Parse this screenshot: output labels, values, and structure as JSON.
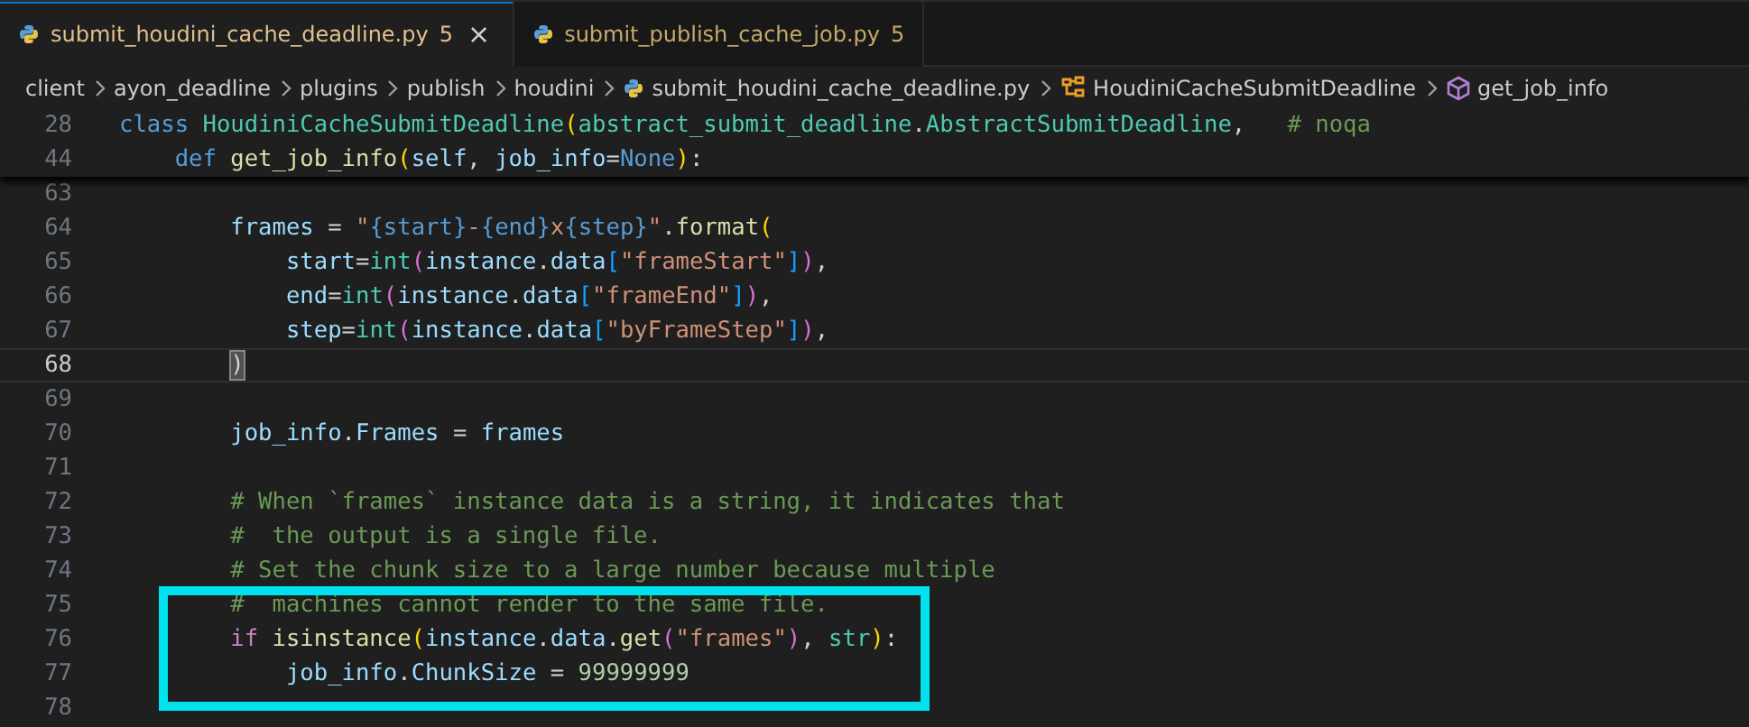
{
  "tabs": [
    {
      "label": "submit_houdini_cache_deadline.py",
      "problems": "5",
      "close": "×",
      "selected": true
    },
    {
      "label": "submit_publish_cache_job.py",
      "problems": "5",
      "selected": false
    }
  ],
  "breadcrumbs": [
    {
      "label": "client",
      "kind": "folder"
    },
    {
      "label": "ayon_deadline",
      "kind": "folder"
    },
    {
      "label": "plugins",
      "kind": "folder"
    },
    {
      "label": "publish",
      "kind": "folder"
    },
    {
      "label": "houdini",
      "kind": "folder"
    },
    {
      "label": "submit_houdini_cache_deadline.py",
      "kind": "file"
    },
    {
      "label": "HoudiniCacheSubmitDeadline",
      "kind": "class"
    },
    {
      "label": "get_job_info",
      "kind": "method"
    }
  ],
  "sticky_lines": [
    {
      "number": "28",
      "tokens": [
        {
          "kind": "kw",
          "text": "class"
        },
        {
          "kind": "cls",
          "text": " HoudiniCacheSubmitDeadline"
        },
        {
          "kind": "b1",
          "text": "("
        },
        {
          "kind": "cls",
          "text": "abstract_submit_deadline"
        },
        {
          "kind": "p",
          "text": "."
        },
        {
          "kind": "cls",
          "text": "AbstractSubmitDeadline"
        },
        {
          "kind": "p",
          "text": ","
        },
        {
          "kind": "cmt",
          "text": "   # noqa"
        }
      ]
    },
    {
      "number": "44",
      "tokens": [
        {
          "kind": "kw",
          "text": "    def"
        },
        {
          "kind": "fn",
          "text": " get_job_info"
        },
        {
          "kind": "b1",
          "text": "("
        },
        {
          "kind": "var",
          "text": "self"
        },
        {
          "kind": "p",
          "text": ","
        },
        {
          "kind": "var",
          "text": " job_info"
        },
        {
          "kind": "p",
          "text": "="
        },
        {
          "kind": "kw",
          "text": "None"
        },
        {
          "kind": "b1",
          "text": ")"
        },
        {
          "kind": "p",
          "text": ":"
        }
      ]
    }
  ],
  "lines": [
    {
      "number": "63",
      "current": false,
      "highlighted": false
    },
    {
      "number": "64",
      "current": false,
      "highlighted": false,
      "tokens": [
        {
          "kind": "var",
          "text": "        frames"
        },
        {
          "kind": "p",
          "text": " = "
        },
        {
          "kind": "str",
          "text": "\""
        },
        {
          "kind": "kw",
          "text": "{start}"
        },
        {
          "kind": "str",
          "text": "-"
        },
        {
          "kind": "kw",
          "text": "{end}"
        },
        {
          "kind": "str",
          "text": "x"
        },
        {
          "kind": "kw",
          "text": "{step}"
        },
        {
          "kind": "str",
          "text": "\""
        },
        {
          "kind": "p",
          "text": "."
        },
        {
          "kind": "fn",
          "text": "format"
        },
        {
          "kind": "b1",
          "text": "("
        }
      ]
    },
    {
      "number": "65",
      "current": false,
      "highlighted": false,
      "tokens": [
        {
          "kind": "var",
          "text": "            start"
        },
        {
          "kind": "p",
          "text": "="
        },
        {
          "kind": "cls",
          "text": "int"
        },
        {
          "kind": "b2",
          "text": "("
        },
        {
          "kind": "var",
          "text": "instance"
        },
        {
          "kind": "p",
          "text": "."
        },
        {
          "kind": "var",
          "text": "data"
        },
        {
          "kind": "b3",
          "text": "["
        },
        {
          "kind": "str",
          "text": "\"frameStart\""
        },
        {
          "kind": "b3",
          "text": "]"
        },
        {
          "kind": "b2",
          "text": ")"
        },
        {
          "kind": "p",
          "text": ","
        }
      ]
    },
    {
      "number": "66",
      "current": false,
      "highlighted": false,
      "tokens": [
        {
          "kind": "var",
          "text": "            end"
        },
        {
          "kind": "p",
          "text": "="
        },
        {
          "kind": "cls",
          "text": "int"
        },
        {
          "kind": "b2",
          "text": "("
        },
        {
          "kind": "var",
          "text": "instance"
        },
        {
          "kind": "p",
          "text": "."
        },
        {
          "kind": "var",
          "text": "data"
        },
        {
          "kind": "b3",
          "text": "["
        },
        {
          "kind": "str",
          "text": "\"frameEnd\""
        },
        {
          "kind": "b3",
          "text": "]"
        },
        {
          "kind": "b2",
          "text": ")"
        },
        {
          "kind": "p",
          "text": ","
        }
      ]
    },
    {
      "number": "67",
      "current": false,
      "highlighted": false,
      "tokens": [
        {
          "kind": "var",
          "text": "            step"
        },
        {
          "kind": "p",
          "text": "="
        },
        {
          "kind": "cls",
          "text": "int"
        },
        {
          "kind": "b2",
          "text": "("
        },
        {
          "kind": "var",
          "text": "instance"
        },
        {
          "kind": "p",
          "text": "."
        },
        {
          "kind": "var",
          "text": "data"
        },
        {
          "kind": "b3",
          "text": "["
        },
        {
          "kind": "str",
          "text": "\"byFrameStep\""
        },
        {
          "kind": "b3",
          "text": "]"
        },
        {
          "kind": "b2",
          "text": ")"
        },
        {
          "kind": "p",
          "text": ","
        }
      ]
    },
    {
      "number": "68",
      "current": true,
      "highlighted": false,
      "tokens": [
        {
          "kind": "match",
          "text": "        )"
        }
      ]
    },
    {
      "number": "69",
      "current": false,
      "highlighted": false
    },
    {
      "number": "70",
      "current": false,
      "highlighted": false,
      "tokens": [
        {
          "kind": "var",
          "text": "        job_info"
        },
        {
          "kind": "p",
          "text": "."
        },
        {
          "kind": "var",
          "text": "Frames"
        },
        {
          "kind": "p",
          "text": " = "
        },
        {
          "kind": "var",
          "text": "frames"
        }
      ]
    },
    {
      "number": "71",
      "current": false,
      "highlighted": false
    },
    {
      "number": "72",
      "current": false,
      "highlighted": false,
      "tokens": [
        {
          "kind": "cmt",
          "text": "        # When `frames` instance data is a string, it indicates that"
        }
      ]
    },
    {
      "number": "73",
      "current": false,
      "highlighted": false,
      "tokens": [
        {
          "kind": "cmt",
          "text": "        #  the output is a single file."
        }
      ]
    },
    {
      "number": "74",
      "current": false,
      "highlighted": false,
      "tokens": [
        {
          "kind": "cmt",
          "text": "        # Set the chunk size to a large number because multiple"
        }
      ]
    },
    {
      "number": "75",
      "current": false,
      "highlighted": true,
      "tokens": [
        {
          "kind": "cmt",
          "text": "        #  machines cannot render to the same file."
        }
      ]
    },
    {
      "number": "76",
      "current": false,
      "highlighted": true,
      "tokens": [
        {
          "kind": "ctrl",
          "text": "        if"
        },
        {
          "kind": "fn",
          "text": " isinstance"
        },
        {
          "kind": "b1",
          "text": "("
        },
        {
          "kind": "var",
          "text": "instance"
        },
        {
          "kind": "p",
          "text": "."
        },
        {
          "kind": "var",
          "text": "data"
        },
        {
          "kind": "p",
          "text": "."
        },
        {
          "kind": "fn",
          "text": "get"
        },
        {
          "kind": "b2",
          "text": "("
        },
        {
          "kind": "str",
          "text": "\"frames\""
        },
        {
          "kind": "b2",
          "text": ")"
        },
        {
          "kind": "p",
          "text": ","
        },
        {
          "kind": "cls",
          "text": " str"
        },
        {
          "kind": "b1",
          "text": ")"
        },
        {
          "kind": "p",
          "text": ":"
        }
      ]
    },
    {
      "number": "77",
      "current": false,
      "highlighted": true,
      "tokens": [
        {
          "kind": "var",
          "text": "            job_info"
        },
        {
          "kind": "p",
          "text": "."
        },
        {
          "kind": "var",
          "text": "ChunkSize"
        },
        {
          "kind": "p",
          "text": " = "
        },
        {
          "kind": "num",
          "text": "99999999"
        }
      ]
    },
    {
      "number": "78",
      "current": false,
      "highlighted": false
    }
  ]
}
